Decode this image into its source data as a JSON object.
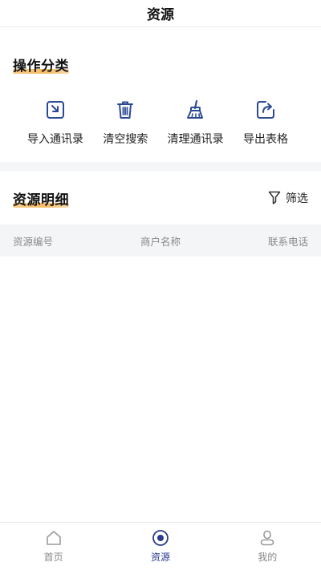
{
  "header": {
    "title": "资源"
  },
  "operations": {
    "title": "操作分类",
    "items": [
      {
        "label": "导入通讯录",
        "icon": "import-icon"
      },
      {
        "label": "清空搜索",
        "icon": "trash-icon"
      },
      {
        "label": "清理通讯录",
        "icon": "broom-icon"
      },
      {
        "label": "导出表格",
        "icon": "export-icon"
      }
    ]
  },
  "details": {
    "title": "资源明细",
    "filter_label": "筛选",
    "columns": [
      "资源编号",
      "商户名称",
      "联系电话"
    ]
  },
  "tabbar": {
    "items": [
      {
        "label": "首页",
        "icon": "home-icon",
        "active": false
      },
      {
        "label": "资源",
        "icon": "resource-icon",
        "active": true
      },
      {
        "label": "我的",
        "icon": "user-icon",
        "active": false
      }
    ]
  },
  "colors": {
    "accent": "#2b3a8c",
    "underline": "#f3b04a",
    "icon": "#2c4a94"
  }
}
